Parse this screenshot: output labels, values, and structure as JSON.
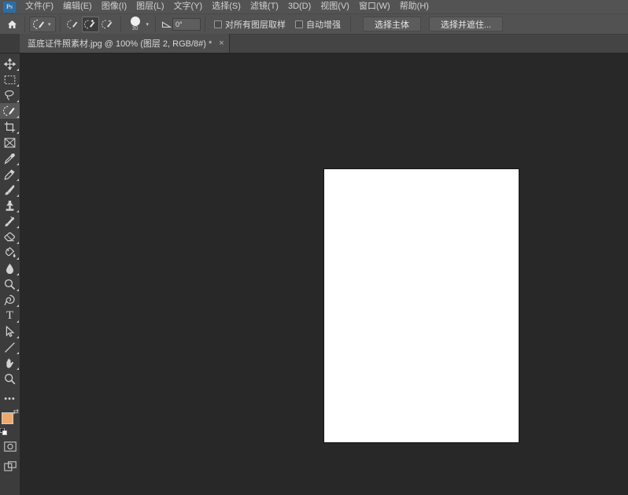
{
  "app": {
    "name": "Adobe Photoshop",
    "logo_text": "Ps",
    "bg_color": "#282828",
    "menubar_color": "#535353",
    "accent_color": "#2a6ea6"
  },
  "menubar": {
    "items": [
      {
        "label": "文件(F)",
        "name": "menu-file"
      },
      {
        "label": "编辑(E)",
        "name": "menu-edit"
      },
      {
        "label": "图像(I)",
        "name": "menu-image"
      },
      {
        "label": "图层(L)",
        "name": "menu-layer"
      },
      {
        "label": "文字(Y)",
        "name": "menu-type"
      },
      {
        "label": "选择(S)",
        "name": "menu-select"
      },
      {
        "label": "滤镜(T)",
        "name": "menu-filter"
      },
      {
        "label": "3D(D)",
        "name": "menu-3d"
      },
      {
        "label": "视图(V)",
        "name": "menu-view"
      },
      {
        "label": "窗口(W)",
        "name": "menu-window"
      },
      {
        "label": "帮助(H)",
        "name": "menu-help"
      }
    ]
  },
  "optionsbar": {
    "home_icon": "home-icon",
    "tool_preset_icon": "quick-selection-tool-icon",
    "modes": [
      {
        "name": "new-selection-mode",
        "icon": "quick-selection-new-icon",
        "active": false
      },
      {
        "name": "add-to-selection-mode",
        "icon": "quick-selection-add-icon",
        "active": true
      },
      {
        "name": "subtract-from-selection-mode",
        "icon": "quick-selection-subtract-icon",
        "active": false
      }
    ],
    "brush_size": "30",
    "angle_value": "0°",
    "checkbox_sample_all_layers": "对所有图层取样",
    "checkbox_auto_enhance": "自动增强",
    "button_select_subject": "选择主体",
    "button_select_and_mask": "选择并遮住..."
  },
  "tabbar": {
    "document_title": "蓝底证件照素材.jpg @ 100% (图层 2, RGB/8#) *",
    "close_glyph": "×"
  },
  "tools": [
    {
      "name": "move-tool",
      "icon": "move-icon",
      "has_flyout": true,
      "active": false
    },
    {
      "name": "rectangular-marquee-tool",
      "icon": "marquee-icon",
      "has_flyout": true,
      "active": false
    },
    {
      "name": "lasso-tool",
      "icon": "lasso-icon",
      "has_flyout": true,
      "active": false
    },
    {
      "name": "quick-selection-tool",
      "icon": "quick-selection-icon",
      "has_flyout": true,
      "active": true
    },
    {
      "name": "crop-tool",
      "icon": "crop-icon",
      "has_flyout": true,
      "active": false
    },
    {
      "name": "frame-tool",
      "icon": "frame-icon",
      "has_flyout": false,
      "active": false
    },
    {
      "name": "eyedropper-tool",
      "icon": "eyedropper-icon",
      "has_flyout": true,
      "active": false
    },
    {
      "name": "spot-healing-brush-tool",
      "icon": "healing-brush-icon",
      "has_flyout": true,
      "active": false
    },
    {
      "name": "brush-tool",
      "icon": "brush-icon",
      "has_flyout": true,
      "active": false
    },
    {
      "name": "clone-stamp-tool",
      "icon": "clone-stamp-icon",
      "has_flyout": true,
      "active": false
    },
    {
      "name": "history-brush-tool",
      "icon": "history-brush-icon",
      "has_flyout": true,
      "active": false
    },
    {
      "name": "eraser-tool",
      "icon": "eraser-icon",
      "has_flyout": true,
      "active": false
    },
    {
      "name": "gradient-tool",
      "icon": "paint-bucket-icon",
      "has_flyout": true,
      "active": false
    },
    {
      "name": "blur-tool",
      "icon": "blur-drop-icon",
      "has_flyout": true,
      "active": false
    },
    {
      "name": "dodge-tool",
      "icon": "dodge-icon",
      "has_flyout": true,
      "active": false
    },
    {
      "name": "pen-tool",
      "icon": "pen-icon",
      "has_flyout": true,
      "active": false
    },
    {
      "name": "type-tool",
      "icon": "type-icon",
      "has_flyout": true,
      "active": false
    },
    {
      "name": "path-selection-tool",
      "icon": "path-selection-icon",
      "has_flyout": true,
      "active": false
    },
    {
      "name": "line-tool",
      "icon": "line-icon",
      "has_flyout": true,
      "active": false
    },
    {
      "name": "hand-tool",
      "icon": "hand-icon",
      "has_flyout": true,
      "active": false
    },
    {
      "name": "zoom-tool",
      "icon": "zoom-icon",
      "has_flyout": false,
      "active": false
    },
    {
      "name": "edit-toolbar",
      "icon": "ellipsis-icon",
      "has_flyout": false,
      "active": false
    }
  ],
  "colors": {
    "foreground": "#f0a868",
    "background": "#ffffff",
    "quickmask_icon": "quick-mask-icon",
    "screenmode_icon": "screen-mode-icon"
  },
  "canvas": {
    "document_color": "#ffffff",
    "zoom_level": "100%",
    "workspace_color": "#282828"
  }
}
